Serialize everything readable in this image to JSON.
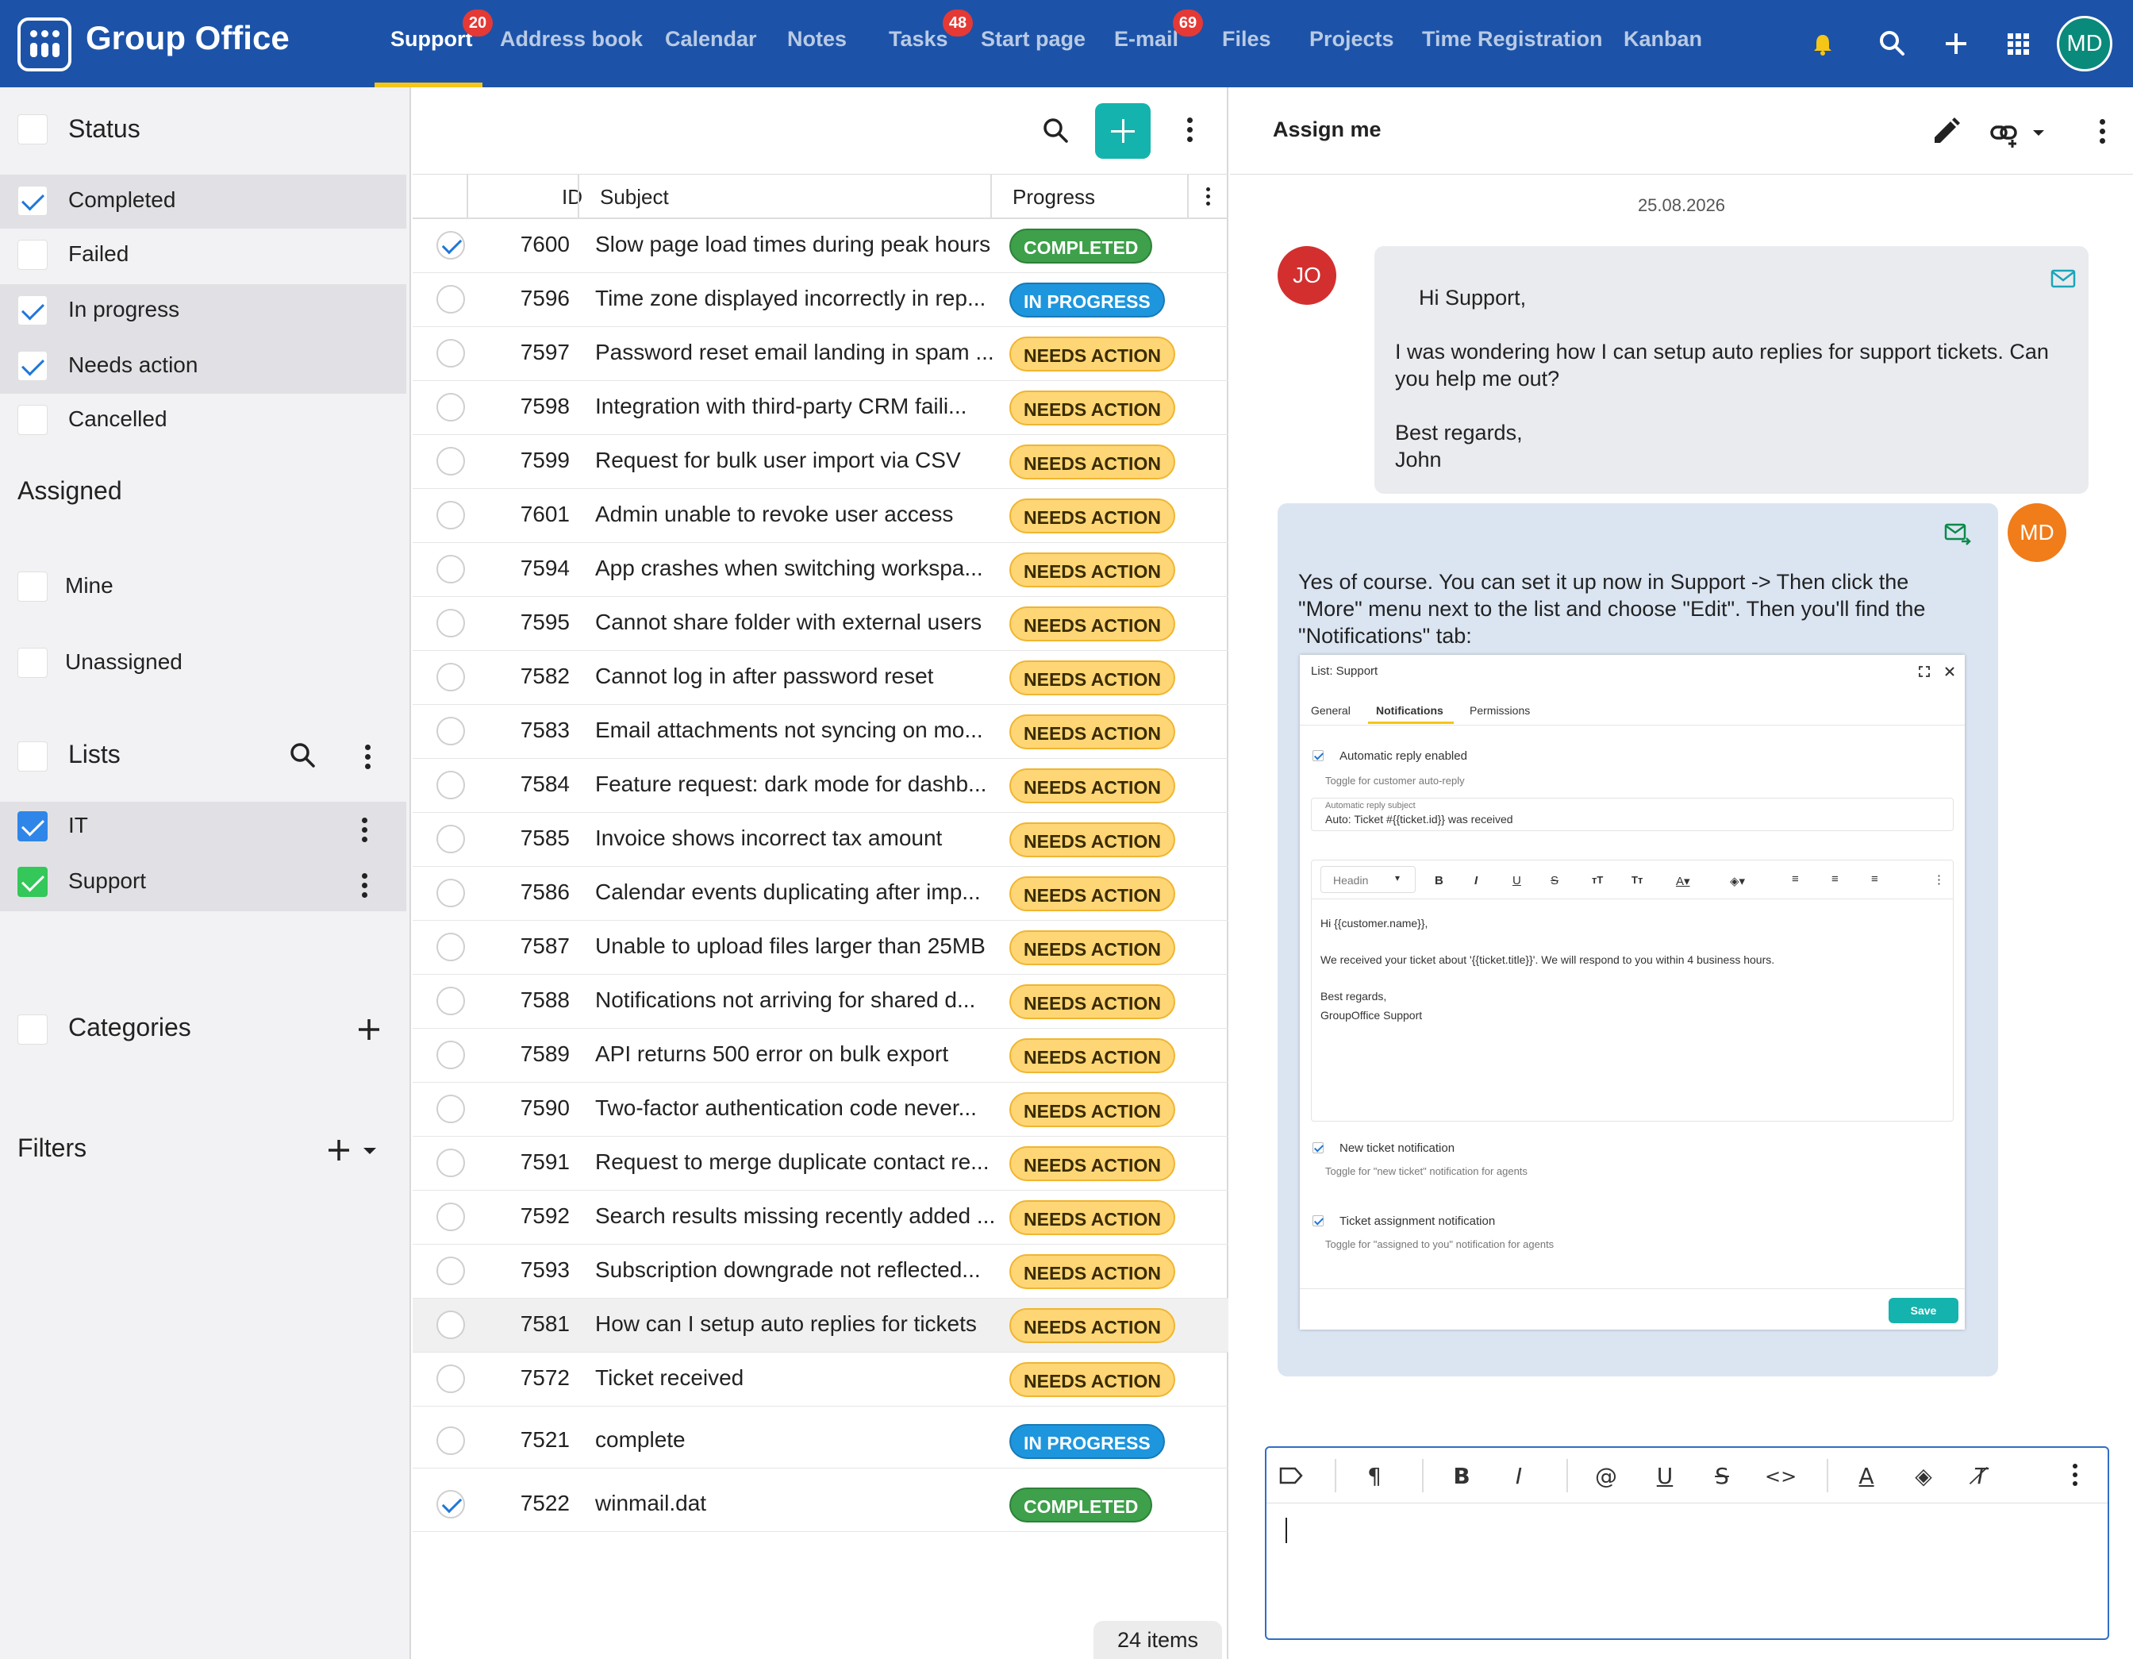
{
  "app": {
    "title": "Group Office"
  },
  "nav": {
    "tabs": [
      {
        "label": "Support",
        "badge": "20"
      },
      {
        "label": "Address book"
      },
      {
        "label": "Calendar"
      },
      {
        "label": "Notes"
      },
      {
        "label": "Tasks",
        "badge": "48"
      },
      {
        "label": "Start page"
      },
      {
        "label": "E-mail",
        "badge": "69"
      },
      {
        "label": "Files"
      },
      {
        "label": "Projects"
      },
      {
        "label": "Time Registration"
      },
      {
        "label": "Kanban"
      }
    ],
    "user_initials": "MD",
    "icons": [
      "bell-icon",
      "search-icon",
      "plus-icon",
      "apps-grid-icon"
    ],
    "accent": "#1c53a8"
  },
  "sidebar": {
    "status": {
      "heading": "Status",
      "items": [
        {
          "label": "Completed",
          "checked": true
        },
        {
          "label": "Failed",
          "checked": false
        },
        {
          "label": "In progress",
          "checked": true
        },
        {
          "label": "Needs action",
          "checked": true
        },
        {
          "label": "Cancelled",
          "checked": false
        }
      ]
    },
    "assigned": {
      "heading": "Assigned",
      "items": [
        {
          "label": "Mine",
          "checked": false
        },
        {
          "label": "Unassigned",
          "checked": false
        }
      ]
    },
    "lists": {
      "heading": "Lists",
      "items": [
        {
          "label": "IT",
          "color": "#2f86e8",
          "checked": true
        },
        {
          "label": "Support",
          "color": "#34c759",
          "checked": true
        }
      ]
    },
    "categories": {
      "heading": "Categories"
    },
    "filters": {
      "heading": "Filters"
    }
  },
  "list": {
    "columns": {
      "id": "ID",
      "subject": "Subject",
      "progress": "Progress"
    },
    "rows": [
      {
        "id": "7600",
        "subject": "Slow page load times during peak hours",
        "status": "COMPLETED",
        "kind": "completed",
        "checked": true
      },
      {
        "id": "7596",
        "subject": "Time zone displayed incorrectly in rep...",
        "status": "IN PROGRESS",
        "kind": "inprogress"
      },
      {
        "id": "7597",
        "subject": "Password reset email landing in spam ...",
        "status": "NEEDS ACTION",
        "kind": "needs"
      },
      {
        "id": "7598",
        "subject": "Integration with third-party CRM faili...",
        "status": "NEEDS ACTION",
        "kind": "needs"
      },
      {
        "id": "7599",
        "subject": "Request for bulk user import via CSV",
        "status": "NEEDS ACTION",
        "kind": "needs"
      },
      {
        "id": "7601",
        "subject": "Admin unable to revoke user access",
        "status": "NEEDS ACTION",
        "kind": "needs"
      },
      {
        "id": "7594",
        "subject": "App crashes when switching workspa...",
        "status": "NEEDS ACTION",
        "kind": "needs"
      },
      {
        "id": "7595",
        "subject": "Cannot share folder with external users",
        "status": "NEEDS ACTION",
        "kind": "needs"
      },
      {
        "id": "7582",
        "subject": "Cannot log in after password reset",
        "status": "NEEDS ACTION",
        "kind": "needs"
      },
      {
        "id": "7583",
        "subject": "Email attachments not syncing on mo...",
        "status": "NEEDS ACTION",
        "kind": "needs"
      },
      {
        "id": "7584",
        "subject": "Feature request: dark mode for dashb...",
        "status": "NEEDS ACTION",
        "kind": "needs"
      },
      {
        "id": "7585",
        "subject": "Invoice shows incorrect tax amount",
        "status": "NEEDS ACTION",
        "kind": "needs"
      },
      {
        "id": "7586",
        "subject": "Calendar events duplicating after imp...",
        "status": "NEEDS ACTION",
        "kind": "needs"
      },
      {
        "id": "7587",
        "subject": "Unable to upload files larger than 25MB",
        "status": "NEEDS ACTION",
        "kind": "needs"
      },
      {
        "id": "7588",
        "subject": "Notifications not arriving for shared d...",
        "status": "NEEDS ACTION",
        "kind": "needs"
      },
      {
        "id": "7589",
        "subject": "API returns 500 error on bulk export",
        "status": "NEEDS ACTION",
        "kind": "needs"
      },
      {
        "id": "7590",
        "subject": "Two-factor authentication code never...",
        "status": "NEEDS ACTION",
        "kind": "needs"
      },
      {
        "id": "7591",
        "subject": "Request to merge duplicate contact re...",
        "status": "NEEDS ACTION",
        "kind": "needs"
      },
      {
        "id": "7592",
        "subject": "Search results missing recently added ...",
        "status": "NEEDS ACTION",
        "kind": "needs"
      },
      {
        "id": "7593",
        "subject": "Subscription downgrade not reflected...",
        "status": "NEEDS ACTION",
        "kind": "needs"
      },
      {
        "id": "7581",
        "subject": "How can I setup auto replies for tickets",
        "status": "NEEDS ACTION",
        "kind": "needs",
        "selected": true
      },
      {
        "id": "7572",
        "subject": "Ticket received",
        "status": "NEEDS ACTION",
        "kind": "needs"
      },
      {
        "id": "7521",
        "subject": "complete",
        "status": "IN PROGRESS",
        "kind": "inprogress"
      },
      {
        "id": "7522",
        "subject": "winmail.dat",
        "status": "COMPLETED",
        "kind": "completed",
        "checked": true
      }
    ],
    "count_label": "24 items"
  },
  "detail": {
    "title": "Assign me",
    "date": "25.08.2026",
    "messages": [
      {
        "initials": "JO",
        "color": "#d32f2f",
        "text": "Hi Support,\n\nI was wondering how I can setup auto replies for support tickets. Can you help me out?\n\nBest regards,\nJohn"
      },
      {
        "initials": "MD",
        "color": "#f07c1a",
        "text": "Yes of course. You can set it up now in Support -> Then click the \"More\" menu next to the list and choose \"Edit\". Then you'll find the \"Notifications\" tab:"
      }
    ],
    "screenshot": {
      "title": "List: Support",
      "tabs": [
        "General",
        "Notifications",
        "Permissions"
      ],
      "auto_reply_label": "Automatic reply enabled",
      "auto_reply_hint": "Toggle for customer auto-reply",
      "subject_label": "Automatic reply subject",
      "subject_value": "Auto: Ticket #{{ticket.id}} was received",
      "heading_select": "Headin",
      "body_line1": "Hi {{customer.name}},",
      "body_line2": "We received your ticket about '{{ticket.title}}'. We will respond to you within 4 business hours.",
      "body_line3": "Best regards,",
      "body_line4": "GroupOffice Support",
      "new_ticket_label": "New ticket notification",
      "new_ticket_hint": "Toggle for \"new ticket\" notification for agents",
      "assign_label": "Ticket assignment notification",
      "assign_hint": "Toggle for \"assigned to you\" notification for agents",
      "save": "Save"
    }
  }
}
